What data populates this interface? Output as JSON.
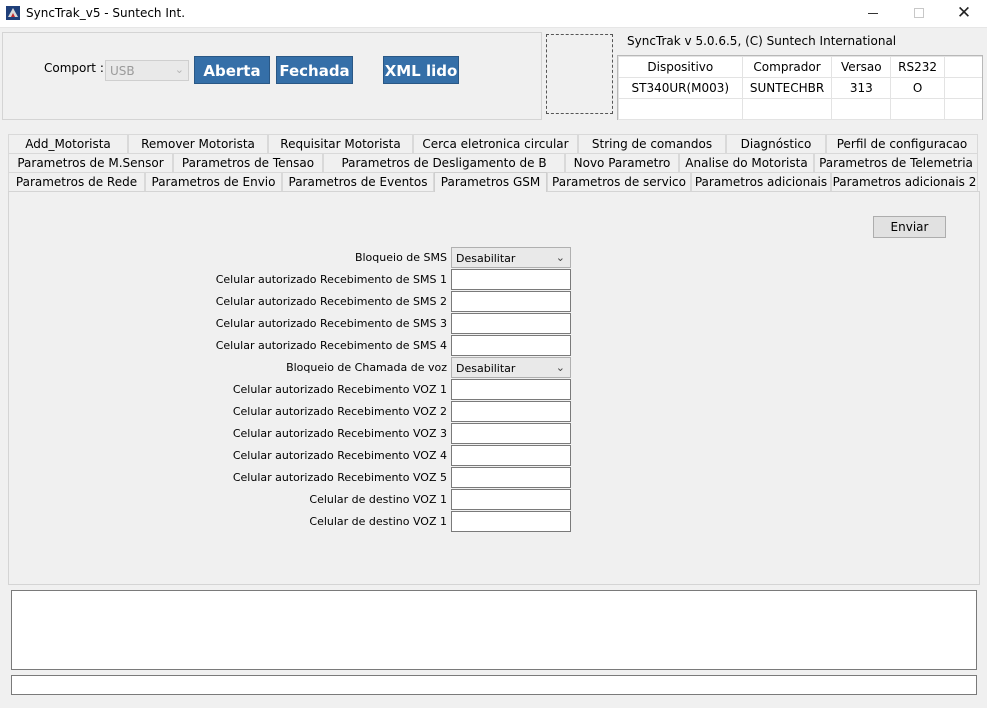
{
  "window": {
    "title": "SyncTrak_v5 - Suntech Int.",
    "icon": "synctrak-app-icon",
    "controls": {
      "minimize": "minimize-icon",
      "maximize": "maximize-icon",
      "close": "✕"
    }
  },
  "connection": {
    "comport_label": "Comport :",
    "comport_value": "USB",
    "buttons": {
      "open": "Aberta",
      "close": "Fechada",
      "xml": "XML lido"
    }
  },
  "device_info": {
    "version_text": "SyncTrak v 5.0.6.5, (C) Suntech International",
    "headers": [
      "Dispositivo",
      "Comprador",
      "Versao",
      "RS232"
    ],
    "row": [
      "ST340UR(M003)",
      "SUNTECHBR",
      "313",
      "O"
    ]
  },
  "tabs": {
    "row1": [
      "Add_Motorista",
      "Remover Motorista",
      "Requisitar Motorista",
      "Cerca eletronica circular",
      "String de comandos",
      "Diagnóstico",
      "Perfil de configuracao"
    ],
    "row2": [
      "Parametros  de M.Sensor",
      "Parametros de Tensao",
      "Parametros de Desligamento de B",
      "Novo Parametro",
      "Analise do Motorista",
      "Parametros de Telemetria"
    ],
    "row3": [
      "Parametros de Rede",
      "Parametros de Envio",
      "Parametros de Eventos",
      "Parametros GSM",
      "Parametros de servico",
      "Parametros adicionais",
      "Parametros adicionais 2"
    ],
    "active": "Parametros GSM"
  },
  "gsm_form": {
    "send_button": "Enviar",
    "fields": [
      {
        "label": "Bloqueio de SMS",
        "type": "select",
        "value": "Desabilitar"
      },
      {
        "label": "Celular autorizado Recebimento de SMS 1",
        "type": "text",
        "value": ""
      },
      {
        "label": "Celular autorizado Recebimento de SMS 2",
        "type": "text",
        "value": ""
      },
      {
        "label": "Celular autorizado Recebimento de SMS 3",
        "type": "text",
        "value": ""
      },
      {
        "label": "Celular autorizado Recebimento de SMS 4",
        "type": "text",
        "value": ""
      },
      {
        "label": "Bloqueio de Chamada de voz",
        "type": "select",
        "value": "Desabilitar"
      },
      {
        "label": "Celular autorizado Recebimento VOZ 1",
        "type": "text",
        "value": ""
      },
      {
        "label": "Celular autorizado Recebimento VOZ 2",
        "type": "text",
        "value": ""
      },
      {
        "label": "Celular autorizado Recebimento VOZ 3",
        "type": "text",
        "value": ""
      },
      {
        "label": "Celular autorizado Recebimento VOZ 4",
        "type": "text",
        "value": ""
      },
      {
        "label": "Celular autorizado Recebimento VOZ 5",
        "type": "text",
        "value": ""
      },
      {
        "label": "Celular de destino VOZ 1",
        "type": "text",
        "value": ""
      },
      {
        "label": "Celular de destino VOZ 1",
        "type": "text",
        "value": ""
      }
    ]
  },
  "log": {
    "text": ""
  },
  "status": {
    "text": ""
  },
  "colors": {
    "button_blue": "#356fa8",
    "window_bg": "#f0f0f0"
  }
}
